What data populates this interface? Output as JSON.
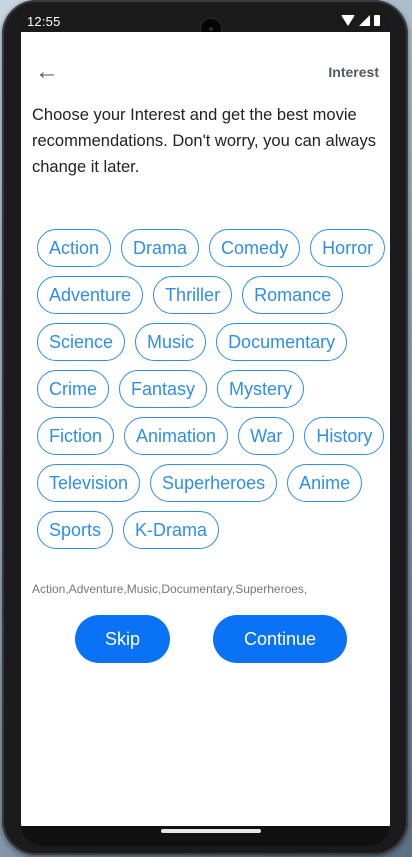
{
  "status_bar": {
    "time": "12:55"
  },
  "header": {
    "back_icon": "arrow-left-icon",
    "back_glyph": "←",
    "title": "Interest"
  },
  "intro_text": "Choose your Interest and get the best movie recommendations. Don't worry, you can always change it later.",
  "genres": [
    "Action",
    "Drama",
    "Comedy",
    "Horror",
    "Adventure",
    "Thriller",
    "Romance",
    "Science",
    "Music",
    "Documentary",
    "Crime",
    "Fantasy",
    "Mystery",
    "Fiction",
    "Animation",
    "War",
    "History",
    "Television",
    "Superheroes",
    "Anime",
    "Sports",
    "K-Drama"
  ],
  "selected_summary": "Action,Adventure,Music,Documentary,Superheroes,",
  "buttons": {
    "skip": "Skip",
    "continue": "Continue"
  },
  "colors": {
    "accent": "#0a72f5",
    "chip_outline": "#2f8ee6"
  }
}
